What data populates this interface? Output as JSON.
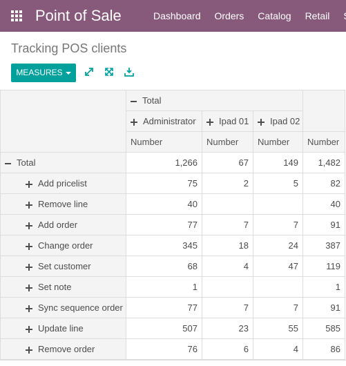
{
  "app": {
    "title": "Point of Sale",
    "nav": [
      "Dashboard",
      "Orders",
      "Catalog",
      "Retail",
      "SM"
    ]
  },
  "page": {
    "title": "Tracking POS clients"
  },
  "toolbar": {
    "measures_label": "MEASURES",
    "icons": [
      "expand-icon",
      "fullscreen-icon",
      "download-icon"
    ]
  },
  "colors": {
    "brand": "#875a7b",
    "accent": "#00a09d"
  },
  "pivot": {
    "col_group_label": "Total",
    "columns": [
      "Administrator",
      "Ipad 01",
      "Ipad 02"
    ],
    "measure_label": "Number",
    "rows": [
      {
        "label": "Total",
        "values": [
          "1,266",
          "67",
          "149"
        ],
        "total": "1,482"
      },
      {
        "label": "Add pricelist",
        "values": [
          "75",
          "2",
          "5"
        ],
        "total": "82"
      },
      {
        "label": "Remove line",
        "values": [
          "40",
          "",
          ""
        ],
        "total": "40"
      },
      {
        "label": "Add order",
        "values": [
          "77",
          "7",
          "7"
        ],
        "total": "91"
      },
      {
        "label": "Change order",
        "values": [
          "345",
          "18",
          "24"
        ],
        "total": "387"
      },
      {
        "label": "Set customer",
        "values": [
          "68",
          "4",
          "47"
        ],
        "total": "119"
      },
      {
        "label": "Set note",
        "values": [
          "1",
          "",
          ""
        ],
        "total": "1"
      },
      {
        "label": "Sync sequence order",
        "values": [
          "77",
          "7",
          "7"
        ],
        "total": "91"
      },
      {
        "label": "Update line",
        "values": [
          "507",
          "23",
          "55"
        ],
        "total": "585"
      },
      {
        "label": "Remove order",
        "values": [
          "76",
          "6",
          "4"
        ],
        "total": "86"
      }
    ]
  }
}
